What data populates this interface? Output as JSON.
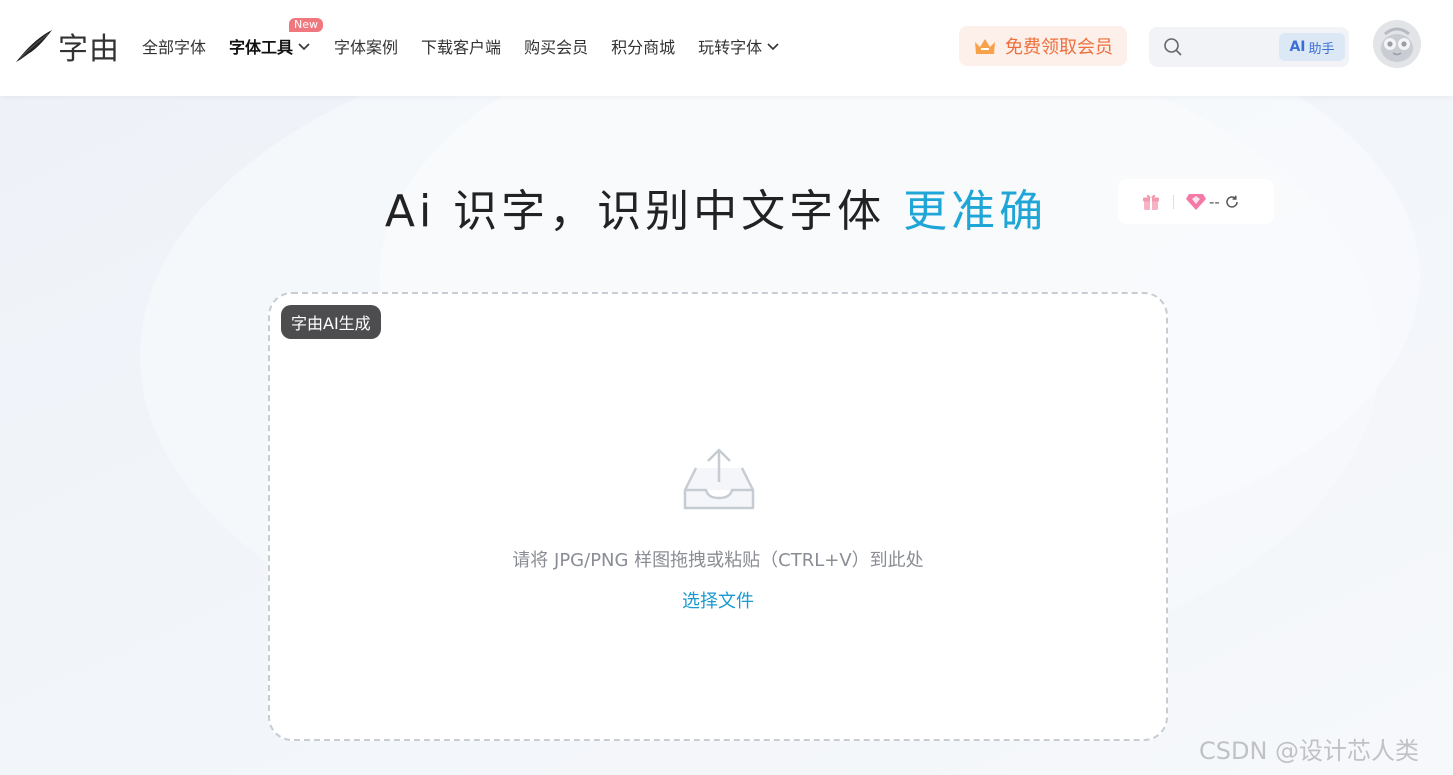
{
  "header": {
    "logo_text": "字由",
    "nav": [
      {
        "label": "全部字体"
      },
      {
        "label": "字体工具",
        "badge": "New"
      },
      {
        "label": "字体案例"
      },
      {
        "label": "下载客户端"
      },
      {
        "label": "购买会员"
      },
      {
        "label": "积分商城"
      },
      {
        "label": "玩转字体"
      }
    ],
    "vip_button": "免费领取会员",
    "search_placeholder": "",
    "ai_chip": {
      "ai": "AI",
      "label": "助手"
    }
  },
  "hero": {
    "title_main": "Ai 识字，识别中文字体 ",
    "title_accent": "更准确",
    "points": "--"
  },
  "upload": {
    "badge": "字由AI生成",
    "hint": "请将 JPG/PNG 样图拖拽或粘贴（CTRL+V）到此处",
    "choose_file": "选择文件"
  },
  "watermark": "CSDN @设计芯人类",
  "colors": {
    "accent": "#1fa6d6",
    "vip_text": "#ee6f3d",
    "vip_bg": "#fdf0ea",
    "new_badge": "#f0777d",
    "link": "#1a9ad0"
  }
}
